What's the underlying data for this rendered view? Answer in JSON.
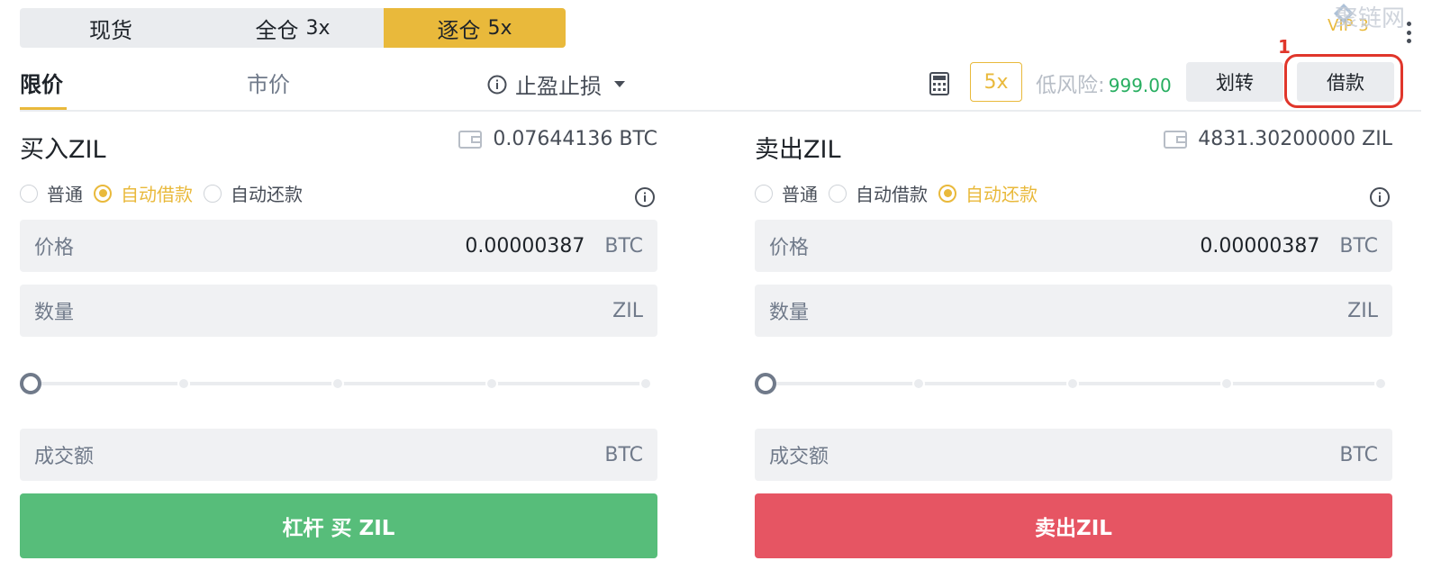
{
  "mode_tabs": [
    {
      "label": "现货",
      "leverage": ""
    },
    {
      "label": "全仓",
      "leverage": "3x"
    },
    {
      "label": "逐仓",
      "leverage": "5x"
    }
  ],
  "vip": "VIP 3",
  "watermark": "聚链网",
  "order_types": {
    "limit": "限价",
    "market": "市价",
    "tpsl": "止盈止损"
  },
  "toolbar": {
    "leverage": "5x",
    "risk_label": "低风险:",
    "risk_value": "999.00",
    "transfer": "划转",
    "borrow": "借款",
    "step_number": "1"
  },
  "buy": {
    "title": "买入ZIL",
    "balance": "0.07644136 BTC",
    "radios": [
      "普通",
      "自动借款",
      "自动还款"
    ],
    "price_label": "价格",
    "price_value": "0.00000387",
    "price_unit": "BTC",
    "qty_label": "数量",
    "qty_unit": "ZIL",
    "total_label": "成交额",
    "total_unit": "BTC",
    "button": "杠杆 买 ZIL"
  },
  "sell": {
    "title": "卖出ZIL",
    "balance": "4831.30200000 ZIL",
    "radios": [
      "普通",
      "自动借款",
      "自动还款"
    ],
    "price_label": "价格",
    "price_value": "0.00000387",
    "price_unit": "BTC",
    "qty_label": "数量",
    "qty_unit": "ZIL",
    "total_label": "成交额",
    "total_unit": "BTC",
    "button": "卖出ZIL"
  },
  "colors": {
    "accent": "#e9b93b",
    "buy": "#57bd7a",
    "sell": "#e65563",
    "risk": "#27ae60",
    "highlight": "#e0362b"
  }
}
